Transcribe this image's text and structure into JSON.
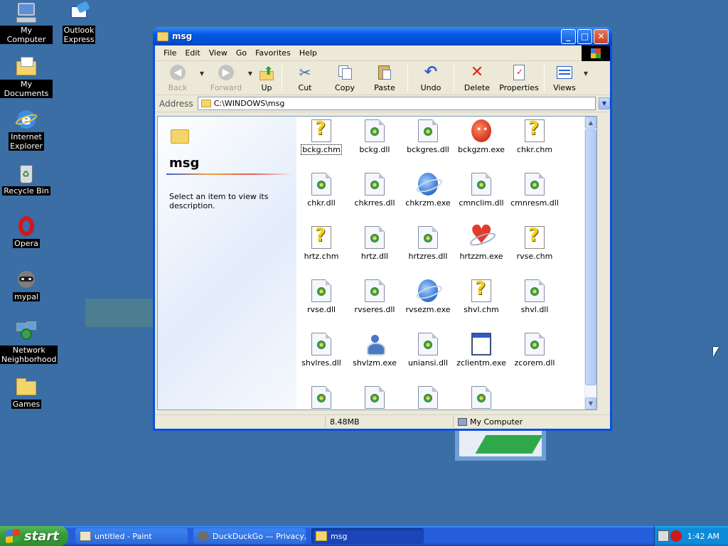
{
  "desktop": {
    "icons": [
      {
        "label": "My Computer",
        "icon": "my-computer-icon"
      },
      {
        "label": "Outlook\nExpress",
        "icon": "outlook-express-icon"
      },
      {
        "label": "My Documents",
        "icon": "my-documents-icon"
      },
      {
        "label": "Internet\nExplorer",
        "icon": "internet-explorer-icon"
      },
      {
        "label": "Recycle Bin",
        "icon": "recycle-bin-icon"
      },
      {
        "label": "Opera",
        "icon": "opera-icon"
      },
      {
        "label": "mypal",
        "icon": "mypal-icon"
      },
      {
        "label": "Network\nNeighborhood",
        "icon": "network-neighborhood-icon"
      },
      {
        "label": "Games",
        "icon": "games-folder-icon"
      }
    ]
  },
  "window": {
    "title": "msg",
    "menu": [
      "File",
      "Edit",
      "View",
      "Go",
      "Favorites",
      "Help"
    ],
    "toolbar": {
      "back": "Back",
      "forward": "Forward",
      "up": "Up",
      "cut": "Cut",
      "copy": "Copy",
      "paste": "Paste",
      "undo": "Undo",
      "delete": "Delete",
      "properties": "Properties",
      "views": "Views"
    },
    "address": {
      "label": "Address",
      "value": "C:\\WINDOWS\\msg"
    },
    "left_pane": {
      "title": "msg",
      "description": "Select an item to view its description."
    },
    "files": [
      {
        "name": "bckg.chm",
        "type": "chm"
      },
      {
        "name": "bckg.dll",
        "type": "dll"
      },
      {
        "name": "bckgres.dll",
        "type": "dll"
      },
      {
        "name": "bckgzm.exe",
        "type": "exe-red"
      },
      {
        "name": "chkr.chm",
        "type": "chm"
      },
      {
        "name": "chkr.dll",
        "type": "dll"
      },
      {
        "name": "chkrres.dll",
        "type": "dll"
      },
      {
        "name": "chkrzm.exe",
        "type": "exe-blue"
      },
      {
        "name": "cmnclim.dll",
        "type": "dll"
      },
      {
        "name": "cmnresm.dll",
        "type": "dll"
      },
      {
        "name": "hrtz.chm",
        "type": "chm"
      },
      {
        "name": "hrtz.dll",
        "type": "dll"
      },
      {
        "name": "hrtzres.dll",
        "type": "dll"
      },
      {
        "name": "hrtzzm.exe",
        "type": "exe-heart"
      },
      {
        "name": "rvse.chm",
        "type": "chm"
      },
      {
        "name": "rvse.dll",
        "type": "dll"
      },
      {
        "name": "rvseres.dll",
        "type": "dll"
      },
      {
        "name": "rvsezm.exe",
        "type": "exe-blue"
      },
      {
        "name": "shvl.chm",
        "type": "chm"
      },
      {
        "name": "shvl.dll",
        "type": "dll"
      },
      {
        "name": "shvlres.dll",
        "type": "dll"
      },
      {
        "name": "shvlzm.exe",
        "type": "exe-person"
      },
      {
        "name": "uniansi.dll",
        "type": "dll"
      },
      {
        "name": "zclientm.exe",
        "type": "exe-win"
      },
      {
        "name": "zcorem.dll",
        "type": "dll"
      },
      {
        "name": "",
        "type": "dll"
      },
      {
        "name": "",
        "type": "dll"
      },
      {
        "name": "",
        "type": "dll"
      },
      {
        "name": "",
        "type": "dll"
      }
    ],
    "status": {
      "size": "8.48MB",
      "location": "My Computer"
    }
  },
  "taskbar": {
    "start": "start",
    "tasks": [
      {
        "label": "untitled - Paint",
        "icon": "paint-icon"
      },
      {
        "label": "DuckDuckGo — Privacy,...",
        "icon": "mypal-icon"
      },
      {
        "label": "msg",
        "icon": "folder-icon"
      }
    ],
    "clock": "1:42 AM"
  },
  "colors": {
    "desktop": "#3a6ea5",
    "titlebar": "#0058e6",
    "taskbar": "#245edb",
    "start": "#379c37"
  }
}
